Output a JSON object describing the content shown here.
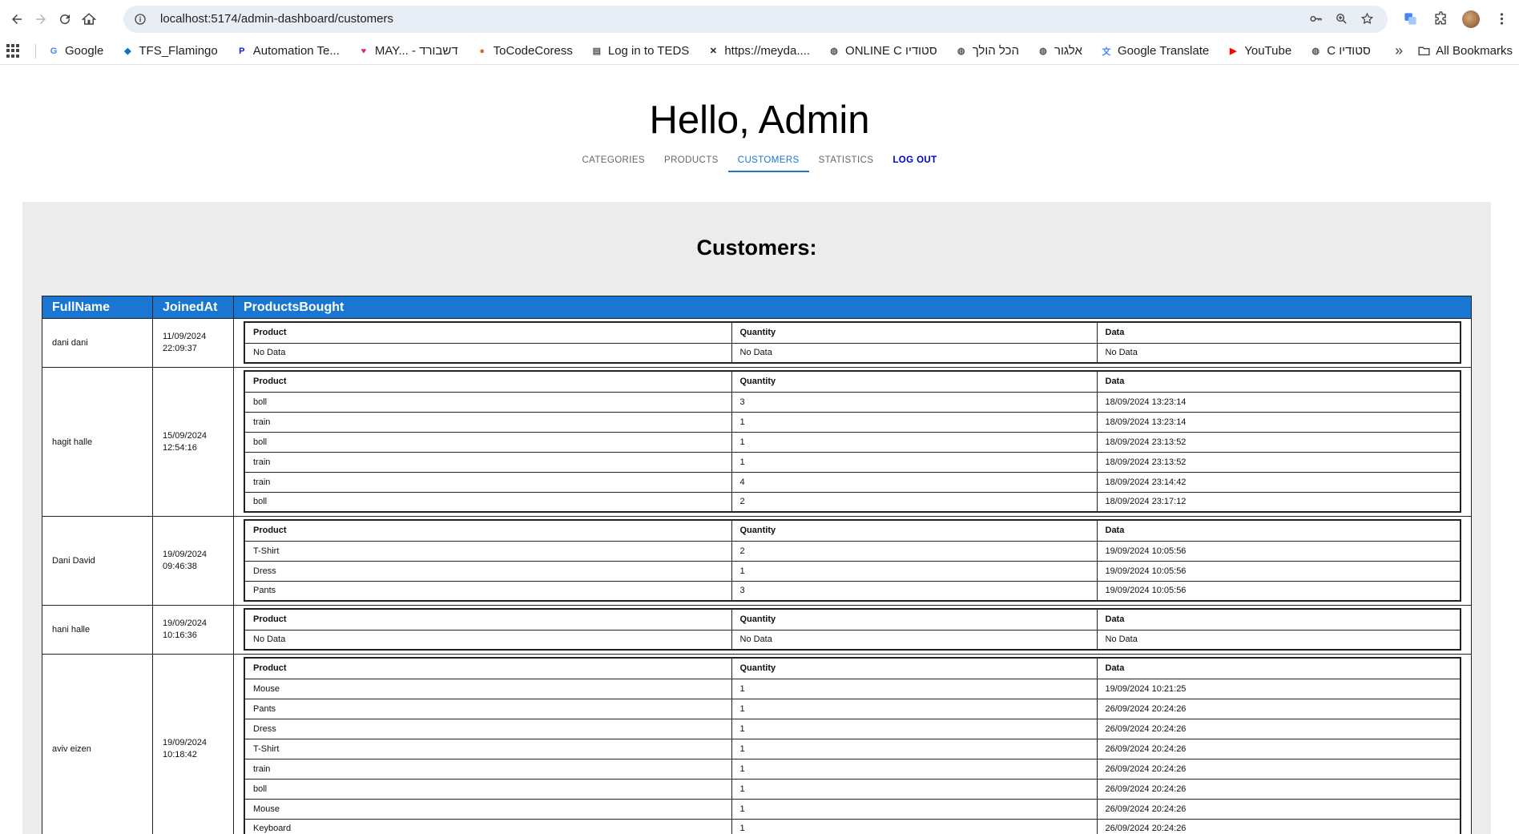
{
  "browser": {
    "url": "localhost:5174/admin-dashboard/customers",
    "bookmarks": [
      {
        "label": "Google",
        "icon": "google-icon",
        "color": "#4285f4",
        "glyph": "G"
      },
      {
        "label": "TFS_Flamingo",
        "icon": "azure-devops-icon",
        "color": "#0078d4",
        "glyph": "◆"
      },
      {
        "label": "Automation Te...",
        "icon": "p-icon",
        "color": "#1a1adb",
        "glyph": "P"
      },
      {
        "label": "MAY... - דשבורד",
        "icon": "heart-icon",
        "color": "#d6278e",
        "glyph": "♥"
      },
      {
        "label": "ToCodeCoress",
        "icon": "tocode-icon",
        "color": "#e0662a",
        "glyph": "●"
      },
      {
        "label": "Log in to TEDS",
        "icon": "teds-icon",
        "color": "#555555",
        "glyph": "▤"
      },
      {
        "label": "https://meyda....",
        "icon": "meyda-icon",
        "color": "#222222",
        "glyph": "✕"
      },
      {
        "label": "ONLINE C סטודיו",
        "icon": "globe-icon",
        "color": "#555555",
        "glyph": "◍"
      },
      {
        "label": "הכל הולך",
        "icon": "globe-icon",
        "color": "#555555",
        "glyph": "◍"
      },
      {
        "label": "אלגור",
        "icon": "globe-icon",
        "color": "#555555",
        "glyph": "◍"
      },
      {
        "label": "Google Translate",
        "icon": "translate-icon",
        "color": "#4285f4",
        "glyph": "文"
      },
      {
        "label": "YouTube",
        "icon": "youtube-icon",
        "color": "#ff0000",
        "glyph": "▶"
      },
      {
        "label": "C סטודיו",
        "icon": "globe-icon",
        "color": "#555555",
        "glyph": "◍"
      }
    ],
    "all_bookmarks": "All Bookmarks",
    "more": "»"
  },
  "page": {
    "greeting": "Hello, Admin",
    "tabs": [
      {
        "label": "CATEGORIES",
        "active": false
      },
      {
        "label": "PRODUCTS",
        "active": false
      },
      {
        "label": "CUSTOMERS",
        "active": true
      },
      {
        "label": "STATISTICS",
        "active": false
      },
      {
        "label": "LOG OUT",
        "active": false
      }
    ],
    "section_title": "Customers:"
  },
  "table": {
    "headers": [
      "FullName",
      "JoinedAt",
      "ProductsBought"
    ],
    "inner_headers": [
      "Product",
      "Quantity",
      "Data"
    ],
    "rows": [
      {
        "name": "dani dani",
        "joined": [
          "11/09/2024",
          "22:09:37"
        ],
        "items": [
          [
            "No Data",
            "No Data",
            "No Data"
          ]
        ]
      },
      {
        "name": "hagit halle",
        "joined": [
          "15/09/2024",
          "12:54:16"
        ],
        "items": [
          [
            "boll",
            "3",
            "18/09/2024 13:23:14"
          ],
          [
            "train",
            "1",
            "18/09/2024 13:23:14"
          ],
          [
            "boll",
            "1",
            "18/09/2024 23:13:52"
          ],
          [
            "train",
            "1",
            "18/09/2024 23:13:52"
          ],
          [
            "train",
            "4",
            "18/09/2024 23:14:42"
          ],
          [
            "boll",
            "2",
            "18/09/2024 23:17:12"
          ]
        ]
      },
      {
        "name": "Dani David",
        "joined": [
          "19/09/2024",
          "09:46:38"
        ],
        "items": [
          [
            "T-Shirt",
            "2",
            "19/09/2024 10:05:56"
          ],
          [
            "Dress",
            "1",
            "19/09/2024 10:05:56"
          ],
          [
            "Pants",
            "3",
            "19/09/2024 10:05:56"
          ]
        ]
      },
      {
        "name": "hani halle",
        "joined": [
          "19/09/2024",
          "10:16:36"
        ],
        "items": [
          [
            "No Data",
            "No Data",
            "No Data"
          ]
        ]
      },
      {
        "name": "aviv eizen",
        "joined": [
          "19/09/2024",
          "10:18:42"
        ],
        "items": [
          [
            "Mouse",
            "1",
            "19/09/2024 10:21:25"
          ],
          [
            "Pants",
            "1",
            "26/09/2024 20:24:26"
          ],
          [
            "Dress",
            "1",
            "26/09/2024 20:24:26"
          ],
          [
            "T-Shirt",
            "1",
            "26/09/2024 20:24:26"
          ],
          [
            "train",
            "1",
            "26/09/2024 20:24:26"
          ],
          [
            "boll",
            "1",
            "26/09/2024 20:24:26"
          ],
          [
            "Mouse",
            "1",
            "26/09/2024 20:24:26"
          ],
          [
            "Keyboard",
            "1",
            "26/09/2024 20:24:26"
          ]
        ]
      },
      {
        "name": "",
        "joined": [
          "",
          ""
        ],
        "items": []
      }
    ]
  },
  "colors": {
    "accent": "#1976d2",
    "logout": "#0000cc",
    "panel": "#ececec"
  }
}
